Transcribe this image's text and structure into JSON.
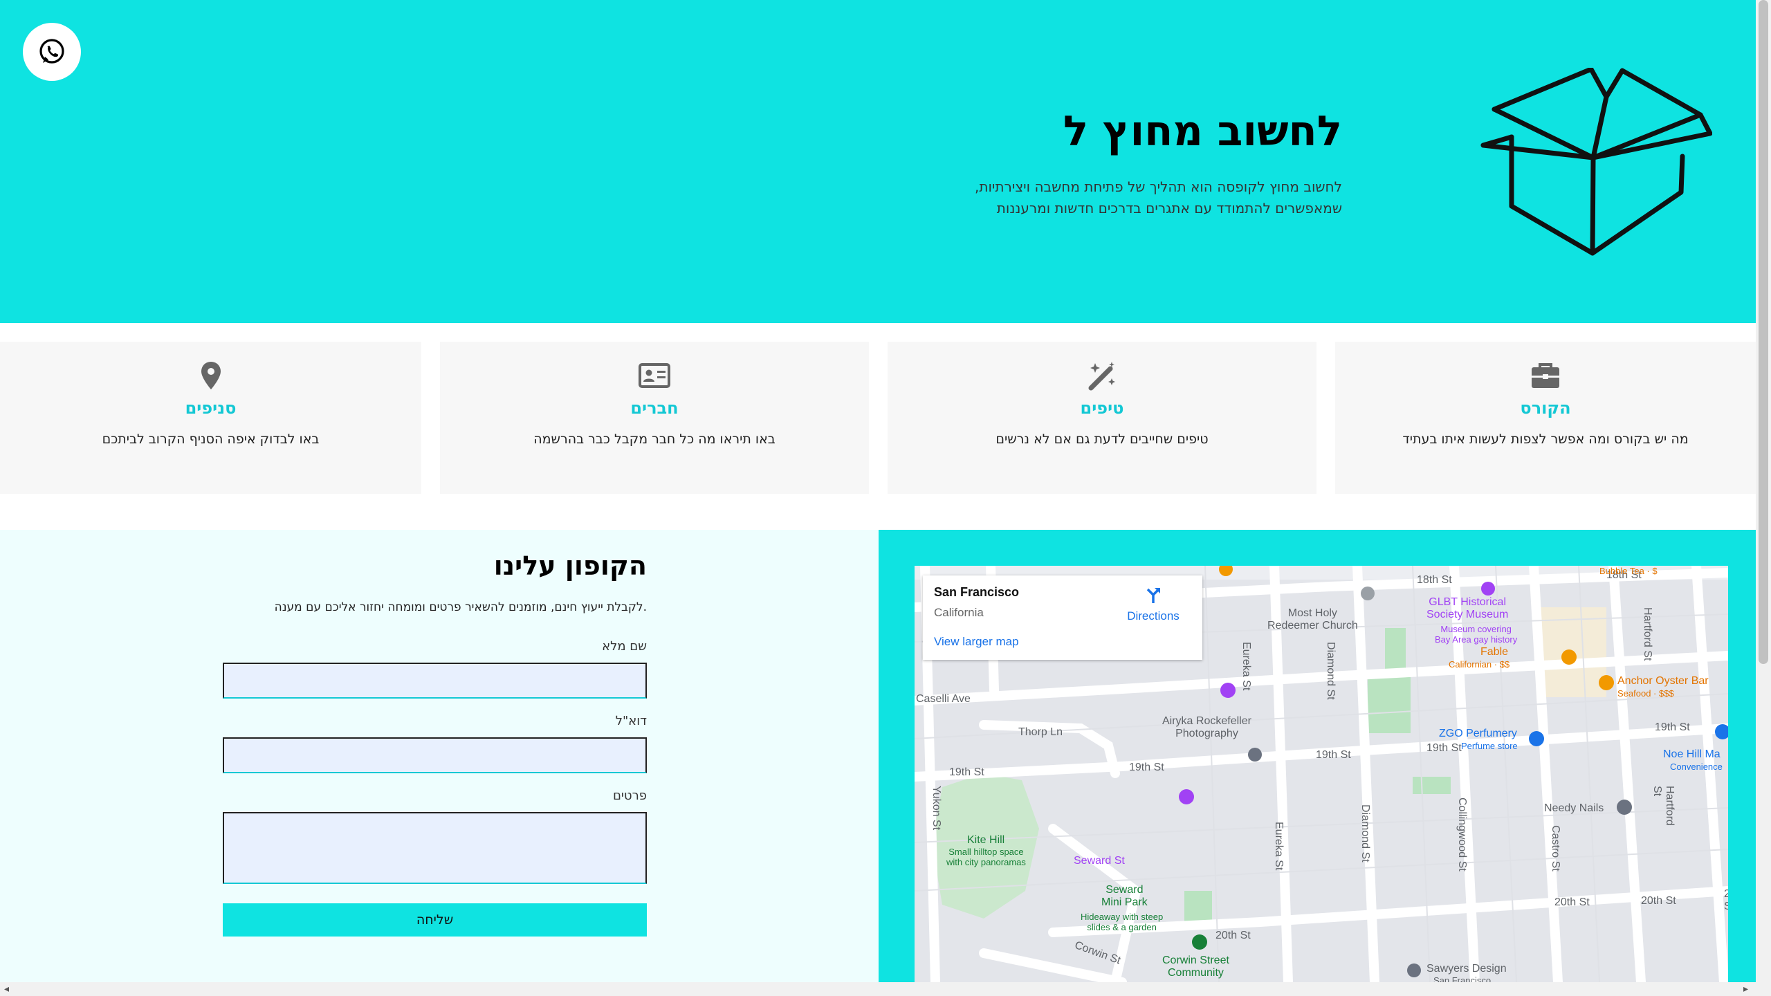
{
  "hero": {
    "title": "לחשוב מחוץ ל",
    "text": "לחשוב מחוץ לקופסה הוא תהליך של פתיחת מחשבה ויצירתיות, שמאפשרים להתמודד עם אתגרים בדרכים חדשות ומרעננות",
    "box_icon": "open-box-icon",
    "whatsapp_icon": "whatsapp-icon"
  },
  "cards": [
    {
      "icon": "briefcase-icon",
      "title": "הקורס",
      "desc": "מה יש בקורס ומה אפשר לצפות לעשות איתו בעתיד"
    },
    {
      "icon": "magic-wand-icon",
      "title": "טיפים",
      "desc": "טיפים שחייבים לדעת גם אם לא נרשים"
    },
    {
      "icon": "id-card-icon",
      "title": "חברים",
      "desc": "באו תיראו מה כל חבר מקבל כבר בהרשמה"
    },
    {
      "icon": "map-pin-icon",
      "title": "סניפים",
      "desc": "באו לבדוק איפה הסניף הקרוב לביתכם"
    }
  ],
  "coupon": {
    "title": "הקופון עלינו",
    "subtitle": ".לקבלת ייעוץ חינם, מוזמנים להשאיר פרטים ומומחה יחזור אליכם עם מענה",
    "name_label": "שם מלא",
    "email_label": "דוא\"ל",
    "details_label": "פרטים",
    "name_value": "",
    "email_value": "",
    "details_value": "",
    "submit": "שליחה"
  },
  "map": {
    "city": "San Francisco",
    "state": "California",
    "directions": "Directions",
    "larger_map": "View larger map",
    "labels": {
      "s18th_a": "18th St",
      "s18th_b": "18th St",
      "caselli": "Caselli Ave",
      "thorp": "Thorp Ln",
      "s19th_a": "19th St",
      "s19th_b": "19th St",
      "s19th_c": "19th St",
      "s19th_d": "19th St",
      "s19th_e": "19th St",
      "s20th_a": "20th St",
      "s20th_b": "20th St",
      "s20th_c": "20th St",
      "eureka_a": "Eureka St",
      "eureka_b": "Eureka St",
      "diamond_a": "Diamond St",
      "diamond_b": "Diamond St",
      "collingwood": "Collingwood St",
      "castro": "Castro St",
      "hartford_a": "Hartford St",
      "hartford_b": "Hartford St",
      "yukon": "Yukon St",
      "corwin": "Corwin St",
      "seward": "Seward St",
      "most_holy": "Most Holy\nRedeemer Church",
      "glbt": "GLBT Historical\nSociety Museum",
      "glbt_sub": "Museum covering\nBay Area gay history",
      "fable": "Fable",
      "fable_sub": "Californian · $$",
      "anchor": "Anchor Oyster Bar",
      "anchor_sub": "Seafood · $$$",
      "zgo": "ZGO Perfumery",
      "zgo_sub": "Perfume store",
      "noe": "Noe Hill Ma",
      "noe_sub": "Convenience",
      "airyka": "Airyka Rockefeller\nPhotography",
      "needy": "Needy Nails",
      "kite": "Kite Hill",
      "kite_sub": "Small hilltop space\nwith city panoramas",
      "seward_mini": "Seward\nMini Park",
      "seward_mini_sub": "Hideaway with steep\nslides & a garden",
      "corwin_comm": "Corwin Street\nCommunity",
      "sawyers": "Sawyers Design",
      "sawyers_sub": "San Francisco",
      "bubble": "Bubble Tea · $"
    }
  }
}
